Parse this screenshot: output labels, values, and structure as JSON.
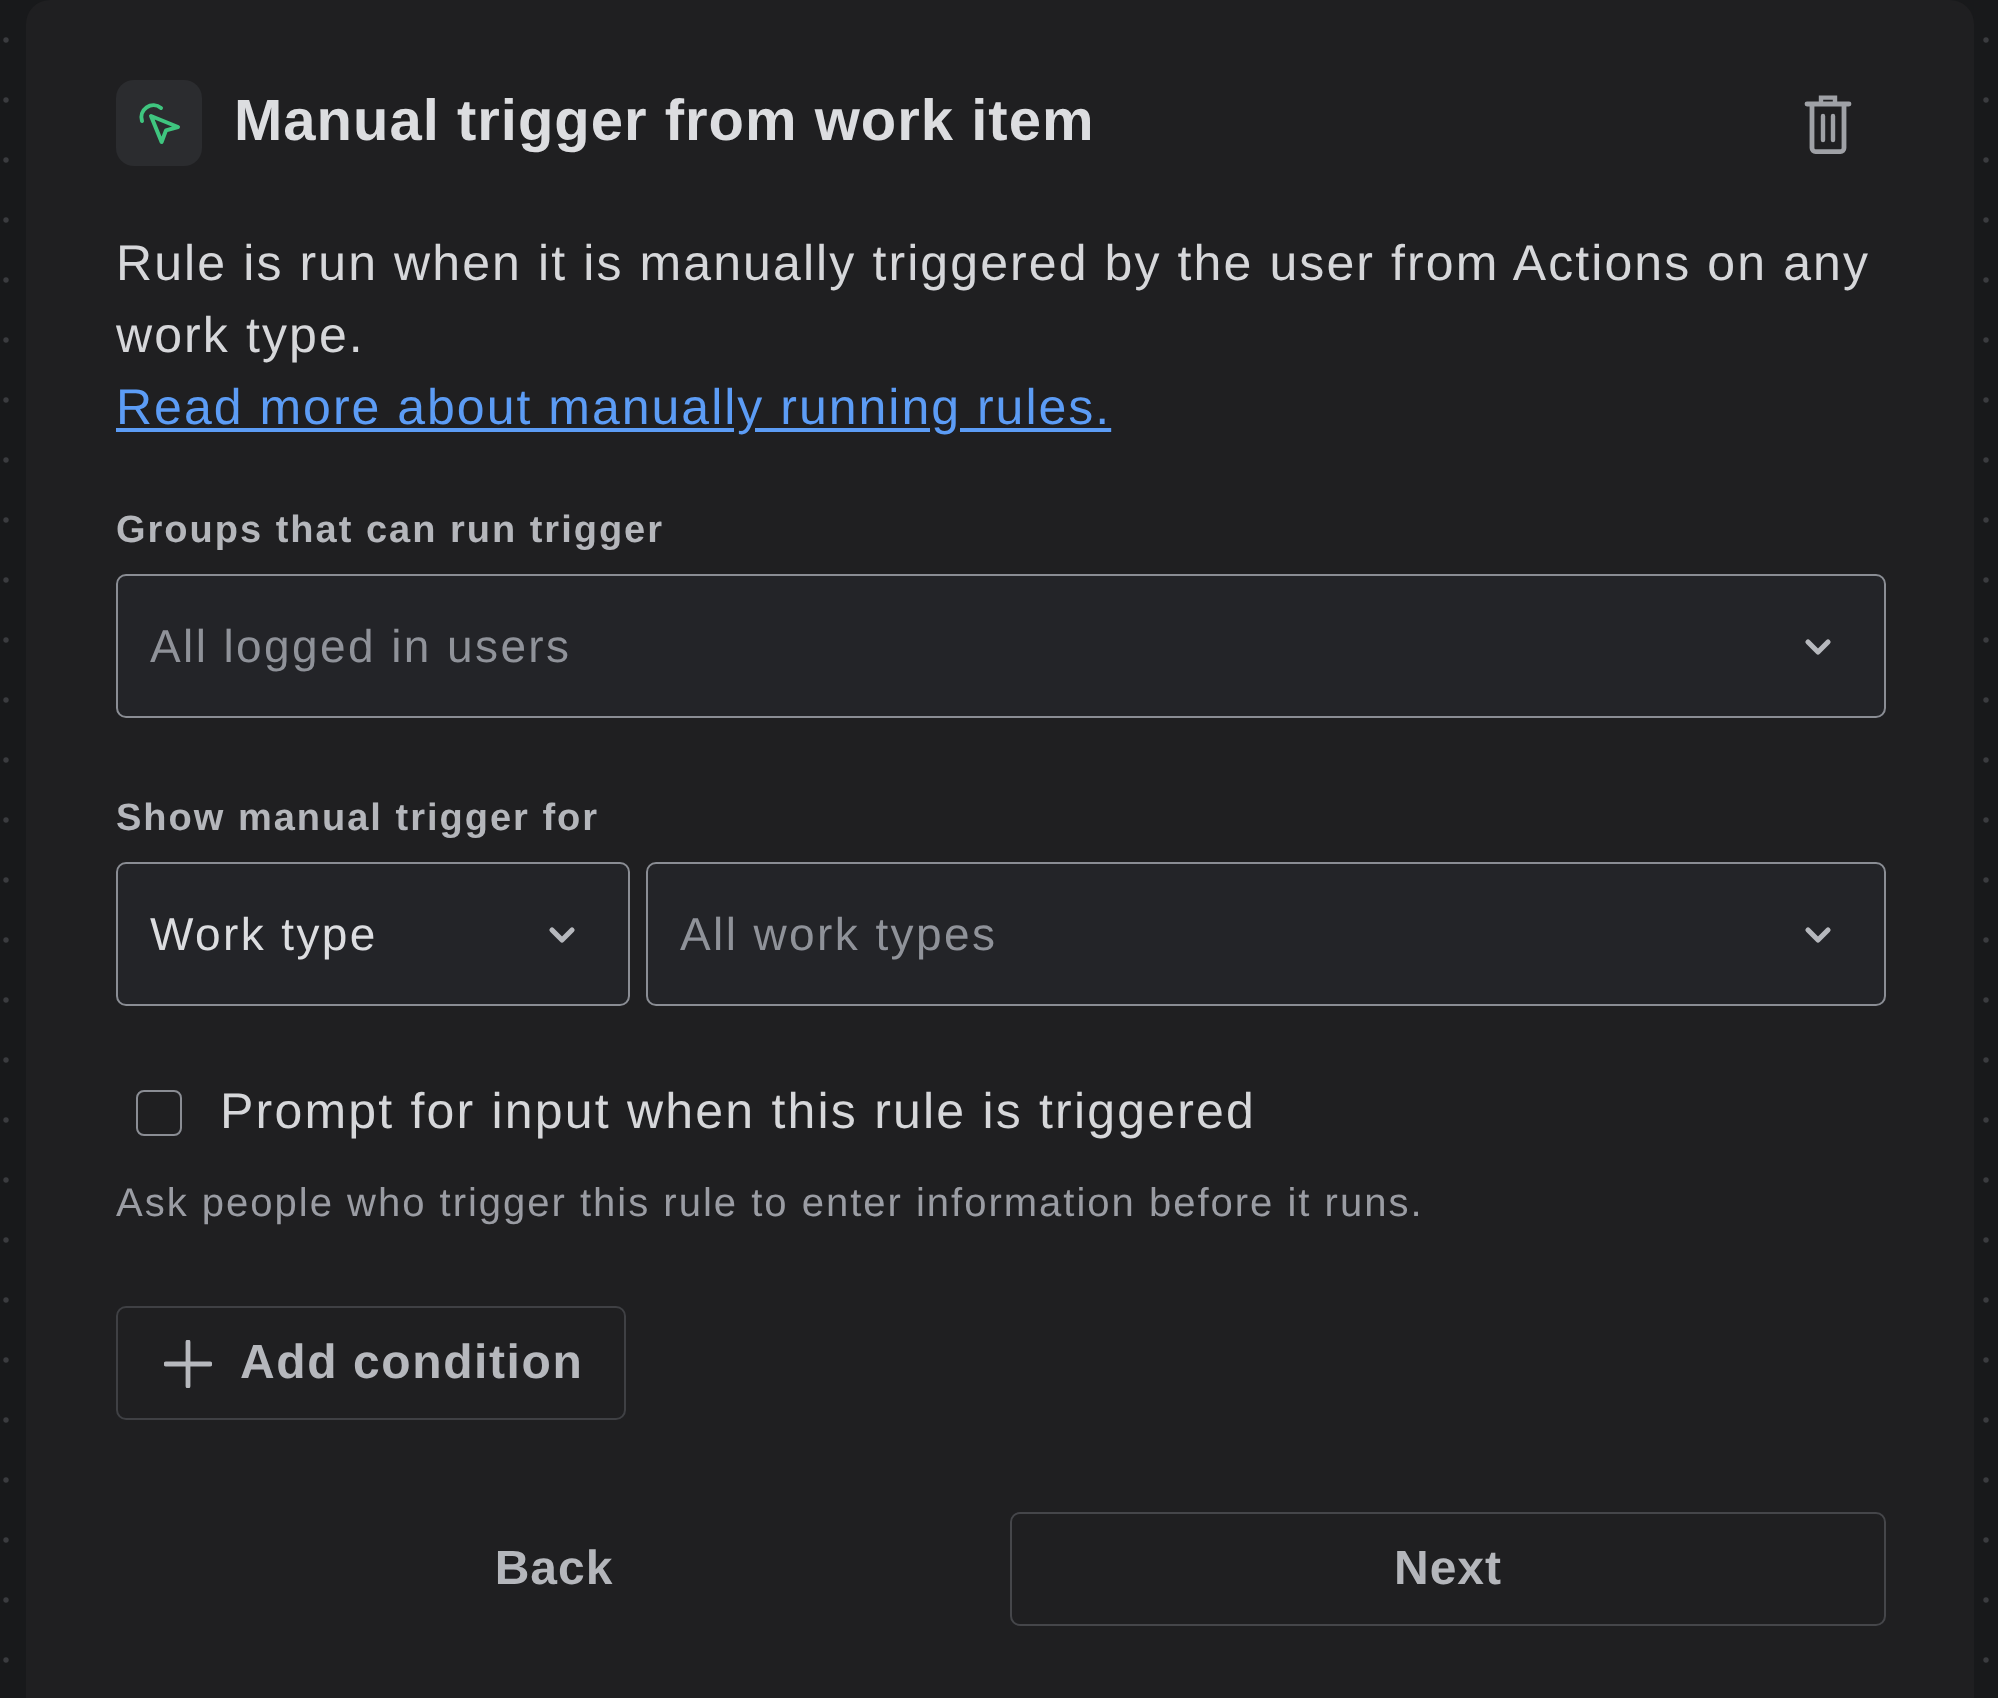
{
  "panel": {
    "title": "Manual trigger from work item",
    "description": "Rule is run when it is manually triggered by the user from Actions on any work type.",
    "link": "Read more about manually running rules."
  },
  "groups_field": {
    "label": "Groups that can run trigger",
    "placeholder": "All logged in users"
  },
  "show_for": {
    "label": "Show manual trigger for",
    "type_select": {
      "value": "Work type"
    },
    "types_select": {
      "placeholder": "All work types"
    }
  },
  "prompt": {
    "label": "Prompt for input when this rule is triggered",
    "checked": false,
    "hint": "Ask people who trigger this rule to enter information before it runs."
  },
  "add_condition": {
    "label": "Add condition"
  },
  "footer": {
    "buttons": [
      {
        "label": "Back",
        "kind": "subtle"
      },
      {
        "label": "Next",
        "kind": "outline"
      }
    ]
  }
}
